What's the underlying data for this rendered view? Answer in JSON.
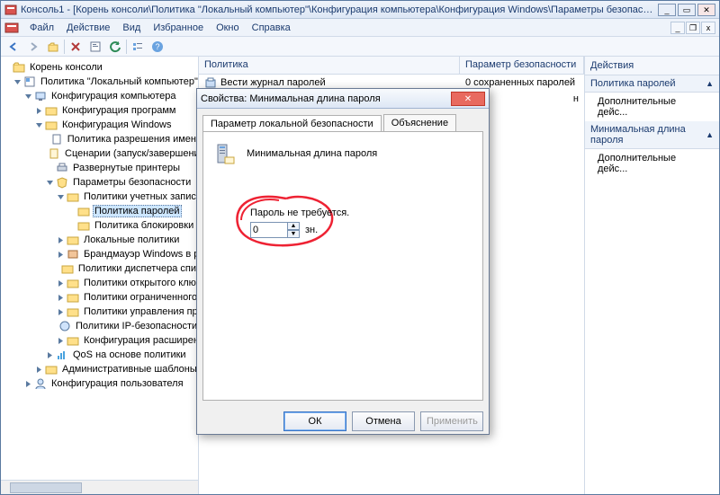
{
  "window": {
    "title": "Консоль1 - [Корень консоли\\Политика \"Локальный компьютер\"\\Конфигурация компьютера\\Конфигурация Windows\\Параметры безопасности\\Политики учетн..."
  },
  "menu": {
    "file": "Файл",
    "action": "Действие",
    "view": "Вид",
    "favorites": "Избранное",
    "window": "Окно",
    "help": "Справка"
  },
  "tree": {
    "root": "Корень консоли",
    "policy": "Политика \"Локальный компьютер\"",
    "compCfg": "Конфигурация компьютера",
    "softCfg": "Конфигурация программ",
    "winCfg": "Конфигурация Windows",
    "nameRes": "Политика разрешения имен",
    "scripts": "Сценарии (запуск/завершени",
    "printers": "Развернутые принтеры",
    "secParams": "Параметры безопасности",
    "acctPol": "Политики учетных записей",
    "pwdPol": "Политика паролей",
    "lockPol": "Политика блокировки",
    "localPol": "Локальные политики",
    "firewall": "Брандмауэр Windows в ре",
    "netlist": "Политики диспетчера спи",
    "pubkey": "Политики открытого клю",
    "restrict": "Политики ограниченного",
    "appctrl": "Политики управления при",
    "ipsec": "Политики IP-безопасности",
    "extcfg": "Конфигурация расширенн",
    "qos": "QoS на основе политики",
    "adminTpl": "Административные шаблоны",
    "userCfg": "Конфигурация пользователя"
  },
  "list": {
    "col1": "Политика",
    "col2": "Параметр безопасности",
    "row1_name": "Вести журнал паролей",
    "row1_val": "0 сохраненных паролей",
    "row2_name": "",
    "row2_val": "н"
  },
  "actions": {
    "header": "Действия",
    "group1": "Политика паролей",
    "more1": "Дополнительные дейс...",
    "group2": "Минимальная длина пароля",
    "more2": "Дополнительные дейс..."
  },
  "dialog": {
    "title": "Свойства: Минимальная длина пароля",
    "tab1": "Параметр локальной безопасности",
    "tab2": "Объяснение",
    "policyName": "Минимальная длина пароля",
    "noPassReq": "Пароль не требуется.",
    "spinValue": "0",
    "unit": "зн.",
    "ok": "ОК",
    "cancel": "Отмена",
    "apply": "Применить"
  }
}
